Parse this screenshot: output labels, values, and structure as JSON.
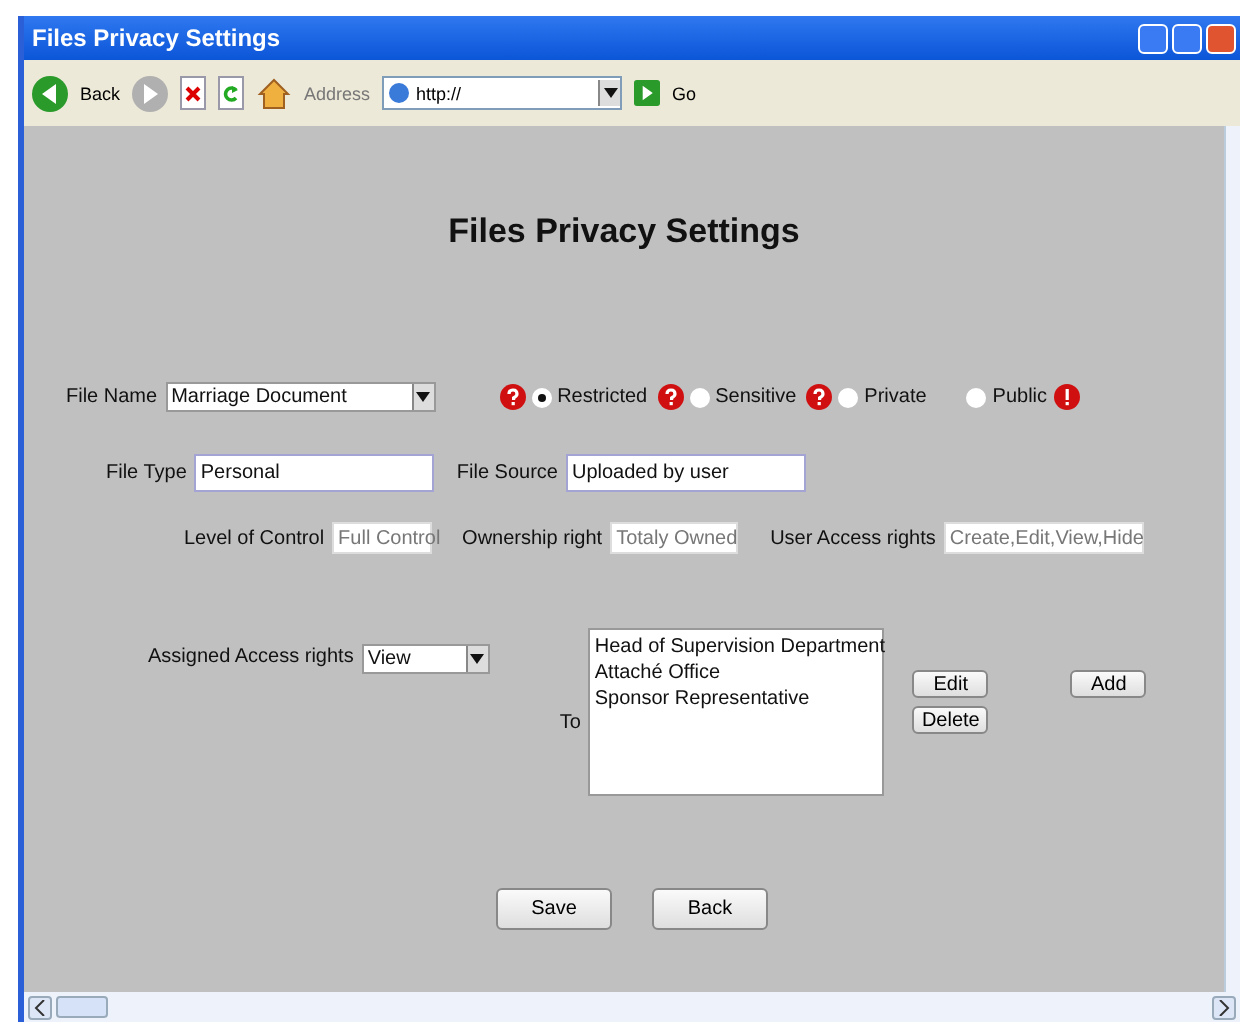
{
  "window": {
    "title": "Files Privacy Settings"
  },
  "toolbar": {
    "back": "Back",
    "address_label": "Address",
    "address": "http://",
    "go": "Go"
  },
  "heading": "Files Privacy Settings",
  "file_name": {
    "label": "File Name",
    "value": "Marriage Document"
  },
  "privacy": [
    {
      "label": "Restricted",
      "selected": true,
      "kind": "help"
    },
    {
      "label": "Sensitive",
      "selected": false,
      "kind": "help"
    },
    {
      "label": "Private",
      "selected": false,
      "kind": "help"
    },
    {
      "label": "Public",
      "selected": false,
      "kind": "warning"
    }
  ],
  "file_type": {
    "label": "File Type",
    "value": "Personal"
  },
  "file_source": {
    "label": "File Source",
    "value": "Uploaded by user"
  },
  "level_of_control": {
    "label": "Level of Control",
    "value": "Full Control"
  },
  "ownership": {
    "label": "Ownership right",
    "value": "Totaly Owned"
  },
  "user_access": {
    "label": "User Access rights",
    "value": "Create,Edit,View,Hide"
  },
  "assigned": {
    "label": "Assigned Access rights",
    "value": "View"
  },
  "to": {
    "label": "To",
    "items": [
      "Head of Supervision Department",
      "Attaché Office",
      "Sponsor Representative"
    ]
  },
  "list_buttons": [
    "Edit",
    "Delete"
  ],
  "add_button": "Add",
  "buttons": [
    "Save",
    "Back"
  ]
}
